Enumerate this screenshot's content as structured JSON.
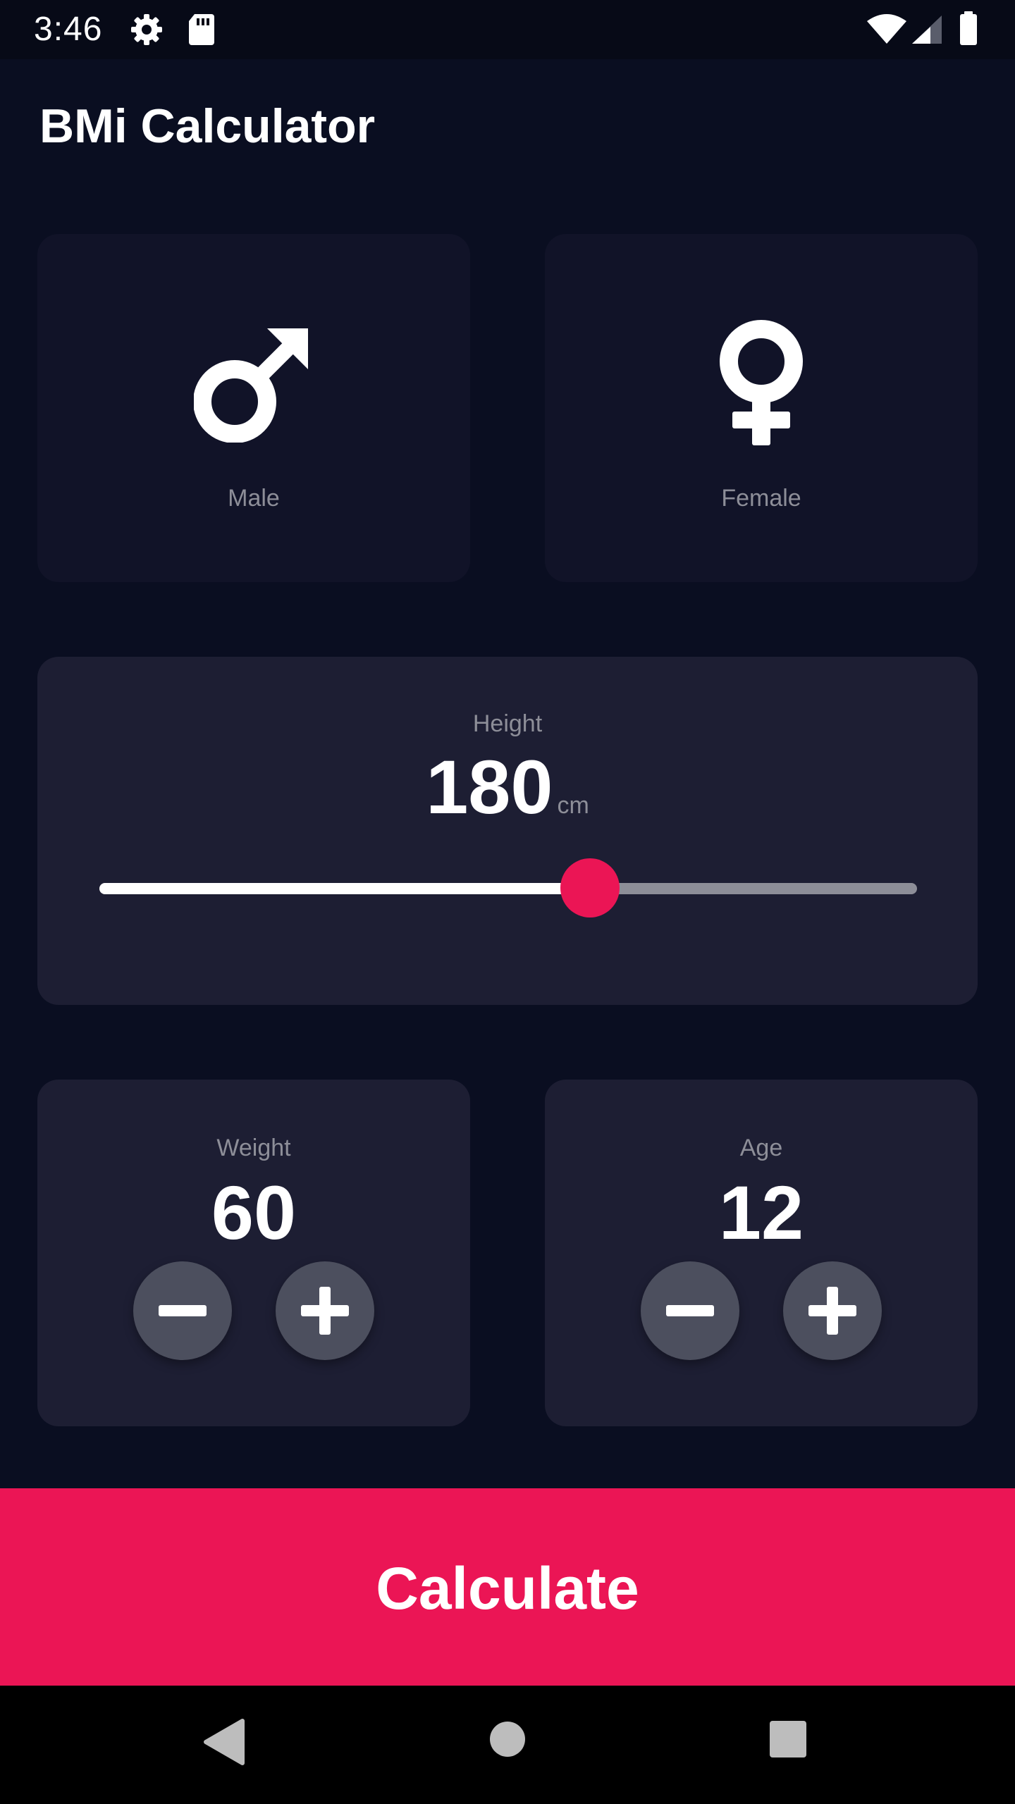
{
  "status_bar": {
    "time": "3:46",
    "icons": [
      "gear-icon",
      "sd-card-icon",
      "wifi-icon",
      "signal-icon",
      "battery-icon"
    ]
  },
  "app": {
    "title": "BMi Calculator"
  },
  "gender": {
    "male_label": "Male",
    "female_label": "Female",
    "icons": [
      "mars-icon",
      "venus-icon"
    ]
  },
  "height": {
    "label": "Height",
    "value": "180",
    "unit": "cm",
    "slider_fraction": 0.6
  },
  "weight": {
    "label": "Weight",
    "value": "60"
  },
  "age": {
    "label": "Age",
    "value": "12"
  },
  "calculate": {
    "label": "Calculate"
  },
  "colors": {
    "background": "#0A0E21",
    "active_card": "#1D1E33",
    "inactive_card": "#111328",
    "accent": "#EB1555",
    "label": "#8D8E98",
    "round_button": "#4C4F5E"
  },
  "navigation": {
    "icons": [
      "back-icon",
      "home-icon",
      "recents-icon"
    ]
  }
}
